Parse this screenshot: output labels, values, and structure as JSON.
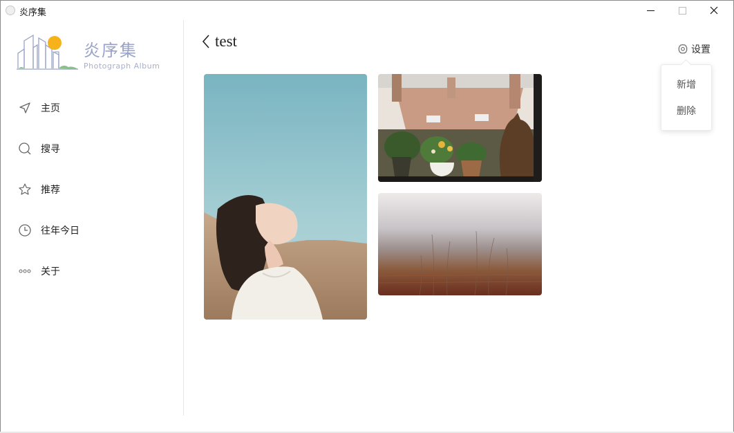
{
  "window": {
    "title": "炎序集",
    "controls": [
      "minimize",
      "maximize",
      "close"
    ]
  },
  "logo": {
    "text": "炎序集",
    "subtitle": "Photograph Album",
    "accent": "#f5b21b"
  },
  "sidebar": {
    "items": [
      {
        "label": "主页",
        "icon": "send-icon"
      },
      {
        "label": "搜寻",
        "icon": "search-icon"
      },
      {
        "label": "推荐",
        "icon": "star-icon"
      },
      {
        "label": "往年今日",
        "icon": "clock-icon"
      },
      {
        "label": "关于",
        "icon": "more-icon"
      }
    ]
  },
  "header": {
    "back_icon": "chevron-left-icon",
    "title": "test"
  },
  "settings": {
    "icon": "gear-icon",
    "label": "设置",
    "menu": [
      "新增",
      "删除"
    ]
  },
  "gallery": [
    {
      "subject": "woman with face tilted toward the sky"
    },
    {
      "subject": "cat sitting by potted plants on a windowsill"
    },
    {
      "subject": "misty autumn meadow"
    }
  ],
  "colors": {
    "sidebar_divider": "#e6e6e6",
    "logo_accent": "#f5b21b",
    "logo_lines": "#9aa3c7"
  }
}
